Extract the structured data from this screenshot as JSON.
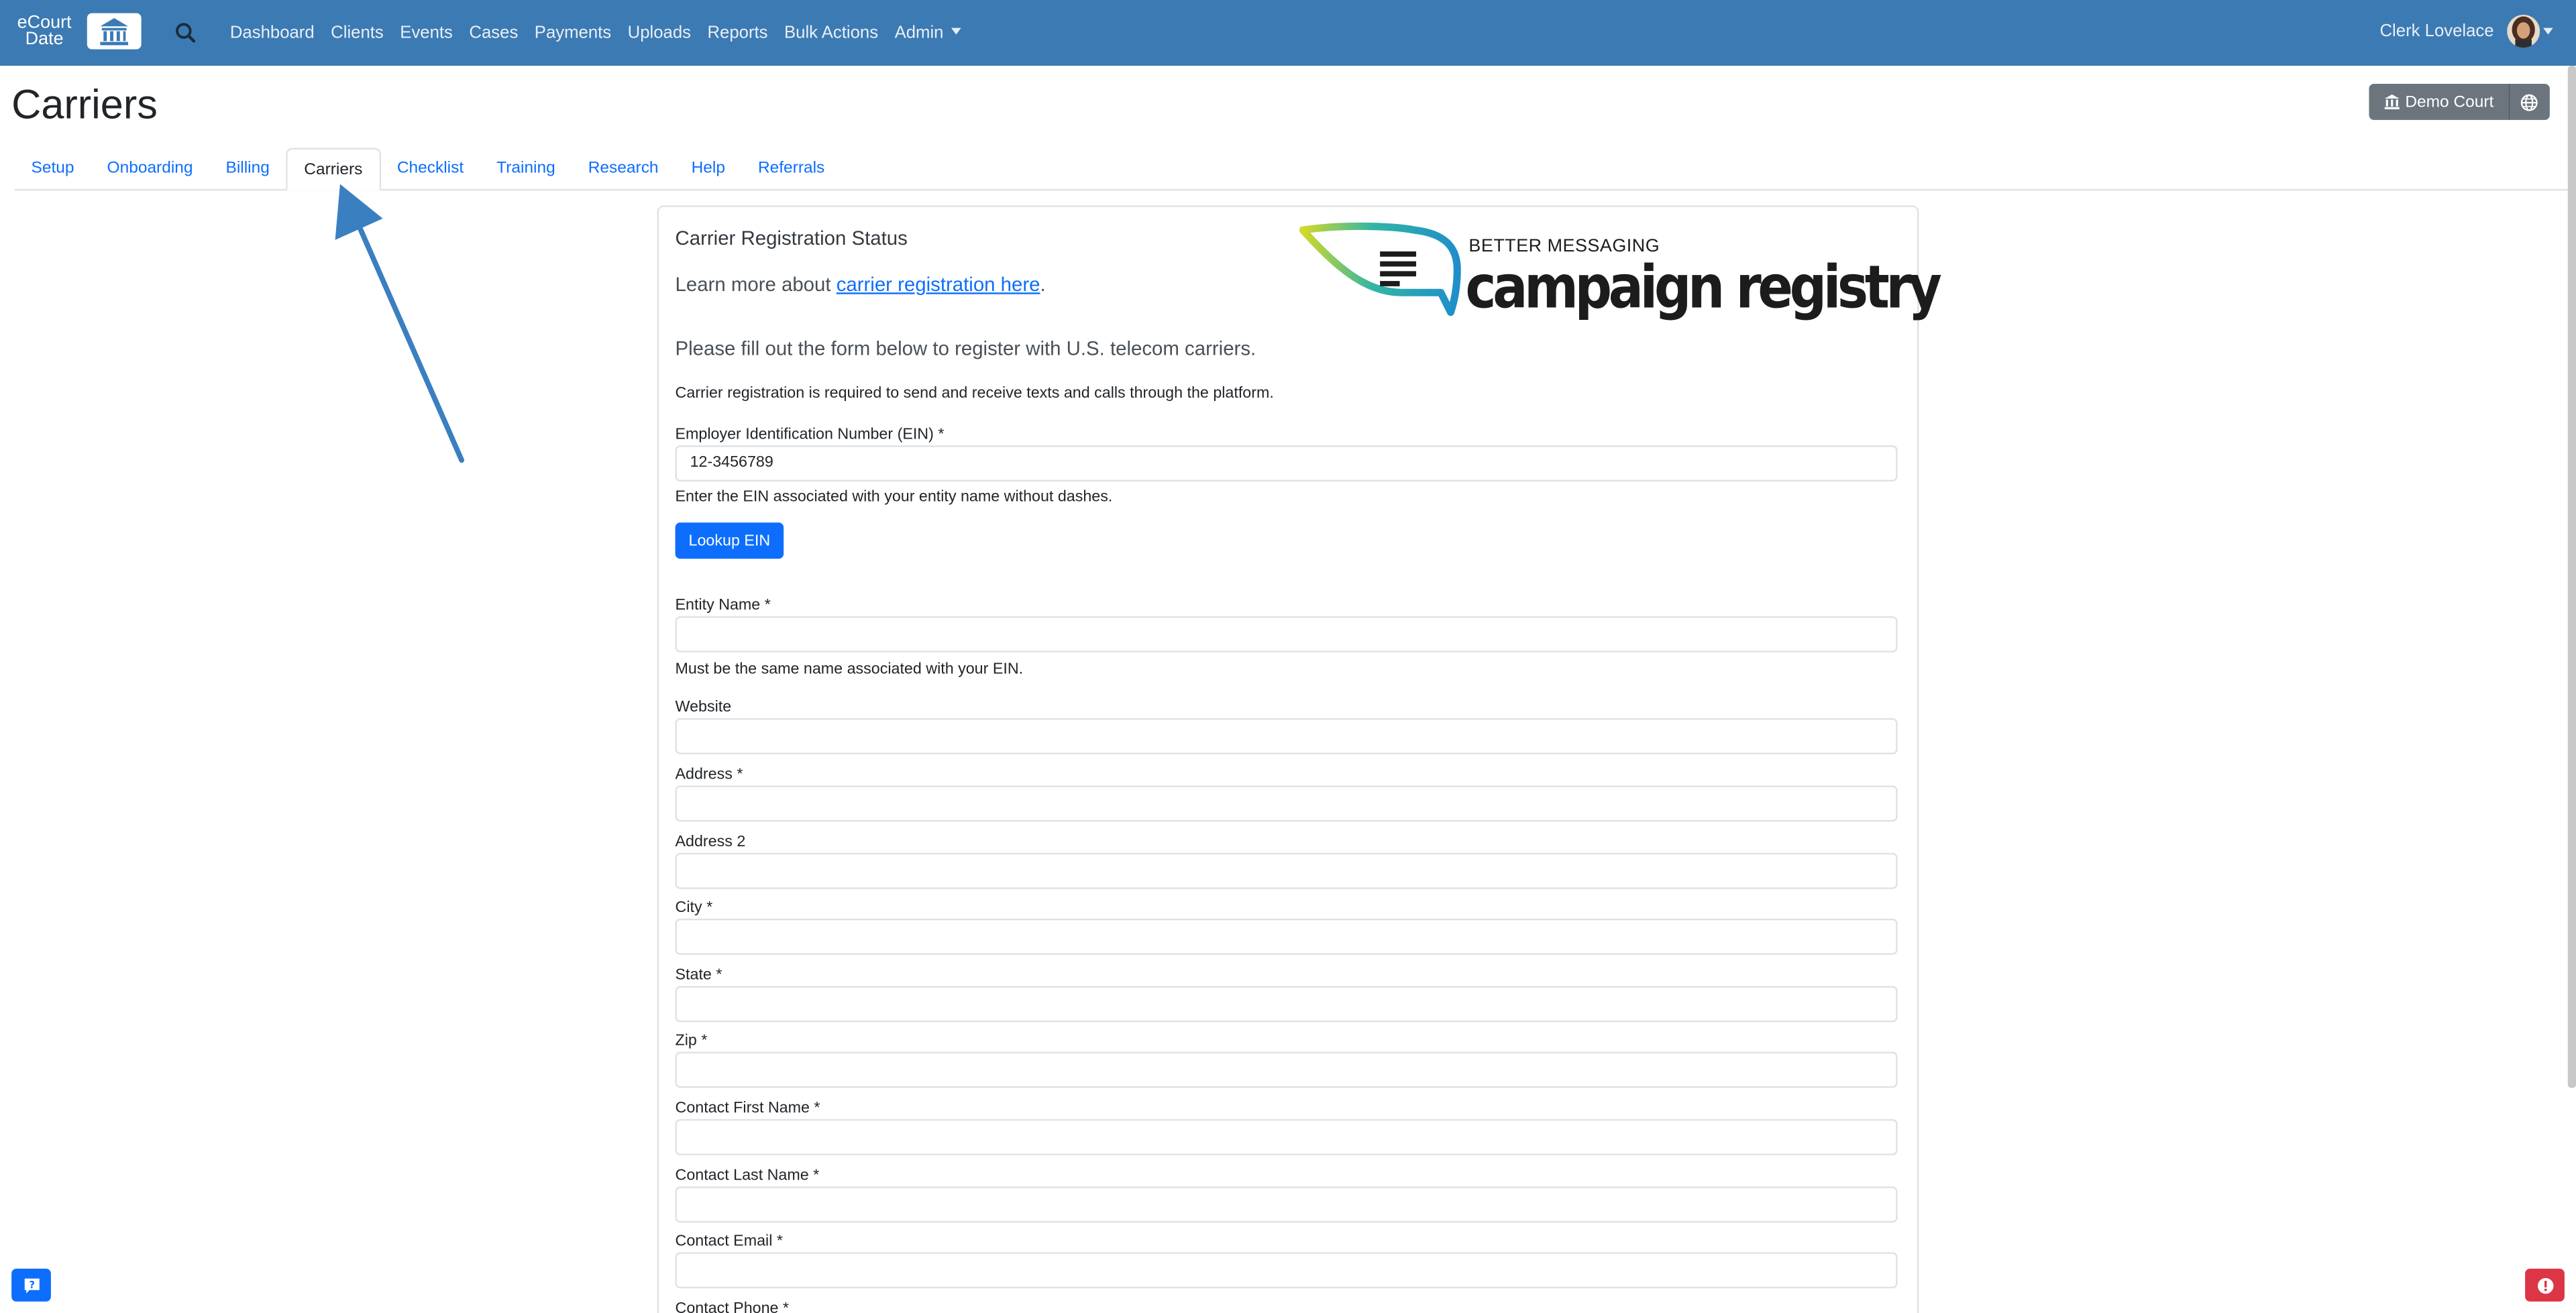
{
  "brand": {
    "line1": "eCourt",
    "line2": "Date"
  },
  "nav": {
    "links": [
      "Dashboard",
      "Clients",
      "Events",
      "Cases",
      "Payments",
      "Uploads",
      "Reports",
      "Bulk Actions"
    ],
    "admin": "Admin",
    "user_name": "Clerk Lovelace"
  },
  "page": {
    "title": "Carriers",
    "court_button": "Demo Court"
  },
  "tabs": [
    {
      "label": "Setup",
      "active": false
    },
    {
      "label": "Onboarding",
      "active": false
    },
    {
      "label": "Billing",
      "active": false
    },
    {
      "label": "Carriers",
      "active": true
    },
    {
      "label": "Checklist",
      "active": false
    },
    {
      "label": "Training",
      "active": false
    },
    {
      "label": "Research",
      "active": false
    },
    {
      "label": "Help",
      "active": false
    },
    {
      "label": "Referrals",
      "active": false
    }
  ],
  "card": {
    "status_title": "Carrier Registration Status",
    "learn_prefix": "Learn more about ",
    "learn_link": "carrier registration here",
    "learn_suffix": ".",
    "please_text": "Please fill out the form below to register with U.S. telecom carriers.",
    "required_text": "Carrier registration is required to send and receive texts and calls through the platform.",
    "logo": {
      "tagline": "BETTER MESSAGING",
      "name": "campaign registry"
    }
  },
  "form": {
    "ein": {
      "label": "Employer Identification Number (EIN) *",
      "value": "12-3456789",
      "hint": "Enter the EIN associated with your entity name without dashes."
    },
    "lookup_button": "Lookup EIN",
    "entity_name": {
      "label": "Entity Name *",
      "value": "",
      "hint": "Must be the same name associated with your EIN."
    },
    "website": {
      "label": "Website",
      "value": ""
    },
    "address": {
      "label": "Address *",
      "value": ""
    },
    "address2": {
      "label": "Address 2",
      "value": ""
    },
    "city": {
      "label": "City *",
      "value": ""
    },
    "state": {
      "label": "State *",
      "value": ""
    },
    "zip": {
      "label": "Zip *",
      "value": ""
    },
    "contact_first": {
      "label": "Contact First Name *",
      "value": ""
    },
    "contact_last": {
      "label": "Contact Last Name *",
      "value": ""
    },
    "contact_email": {
      "label": "Contact Email *",
      "value": ""
    },
    "contact_phone": {
      "label": "Contact Phone *",
      "value": ""
    }
  },
  "colors": {
    "navbar": "#3c7ab3",
    "primary": "#0d6efd",
    "secondary": "#6c757d",
    "danger": "#dc3545",
    "annotation_arrow": "#3a7fc0"
  },
  "icons": {
    "search": "search-icon",
    "court": "bank-icon",
    "globe": "globe-icon",
    "help": "question-icon",
    "alert": "exclamation-icon"
  }
}
